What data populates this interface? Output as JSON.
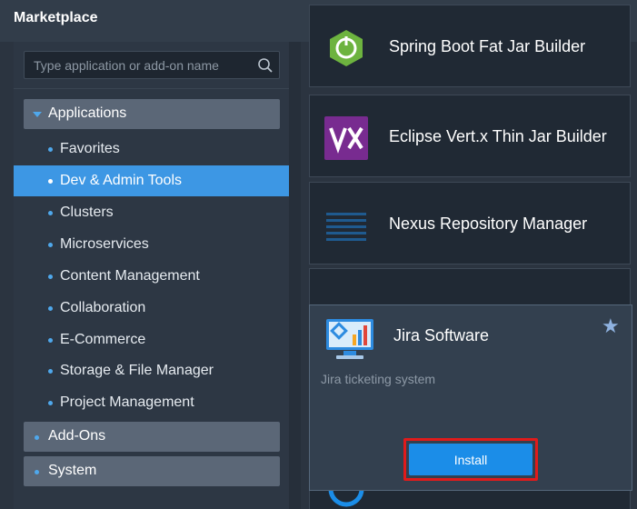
{
  "window": {
    "title": "Marketplace"
  },
  "search": {
    "placeholder": "Type application or add-on name"
  },
  "sidebar": {
    "groups": [
      {
        "label": "Applications"
      },
      {
        "label": "Add-Ons"
      },
      {
        "label": "System"
      }
    ],
    "items": [
      {
        "label": "Favorites"
      },
      {
        "label": "Dev & Admin Tools"
      },
      {
        "label": "Clusters"
      },
      {
        "label": "Microservices"
      },
      {
        "label": "Content Management"
      },
      {
        "label": "Collaboration"
      },
      {
        "label": "E-Commerce"
      },
      {
        "label": "Storage & File Manager"
      },
      {
        "label": "Project Management"
      }
    ],
    "active_item": "Dev & Admin Tools"
  },
  "apps": [
    {
      "name": "Spring Boot Fat Jar Builder",
      "icon": "spring-boot-icon"
    },
    {
      "name": "Eclipse Vert.x Thin Jar Builder",
      "icon": "vertx-icon"
    },
    {
      "name": "Nexus Repository Manager",
      "icon": "nexus-icon"
    },
    {
      "name": "",
      "icon": "wifi-signal-icon"
    },
    {
      "name": "",
      "icon": "blue-circle-icon"
    }
  ],
  "popup": {
    "name": "Jira Software",
    "description": "Jira ticketing system",
    "install_label": "Install",
    "icon": "jira-monitor-icon",
    "favorite_icon": "star-icon"
  },
  "colors": {
    "accent": "#3d97e4",
    "install_button": "#1b8de8",
    "highlight_border": "#e01b1b"
  }
}
